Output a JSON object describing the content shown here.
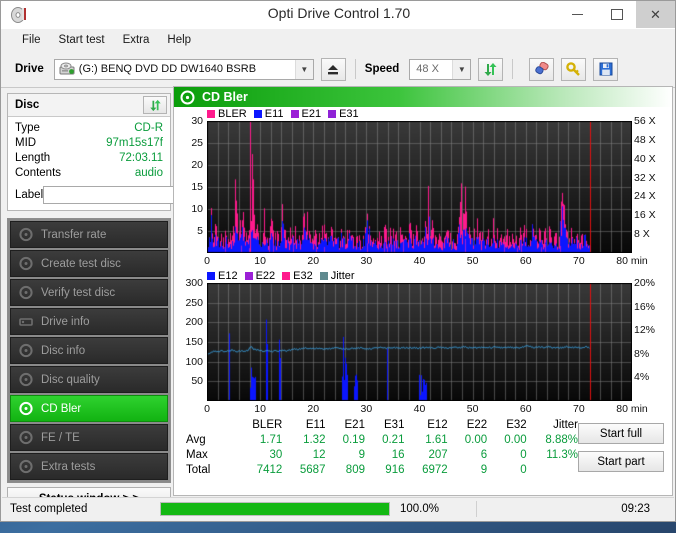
{
  "window": {
    "title": "Opti Drive Control 1.70",
    "icon": "disc-icon",
    "buttons": {
      "minimize": "minimize",
      "maximize": "maximize",
      "close": "close"
    }
  },
  "menu": {
    "items": [
      "File",
      "Start test",
      "Extra",
      "Help"
    ]
  },
  "toolbar": {
    "drive_label": "Drive",
    "drive_value": "(G:)   BENQ DVD DD DW1640 BSRB",
    "eject_icon": "eject-icon",
    "speed_label": "Speed",
    "speed_value": "48 X",
    "refresh_icon": "refresh-icon",
    "eraser_icon": "eraser-icon",
    "key_icon": "key-icon",
    "save_icon": "save-icon"
  },
  "disc": {
    "header": "Disc",
    "refresh_icon": "refresh-icon",
    "rows": [
      {
        "key": "Type",
        "value": "CD-R"
      },
      {
        "key": "MID",
        "value": "97m15s17f"
      },
      {
        "key": "Length",
        "value": "72:03.11"
      },
      {
        "key": "Contents",
        "value": "audio"
      }
    ],
    "label_key": "Label",
    "label_value": "",
    "label_placeholder": "",
    "cd_button_icon": "cd-icon"
  },
  "nav": {
    "items": [
      {
        "label": "Transfer rate",
        "icon": "disc-icon",
        "selected": false
      },
      {
        "label": "Create test disc",
        "icon": "disc-icon",
        "selected": false
      },
      {
        "label": "Verify test disc",
        "icon": "disc-icon",
        "selected": false
      },
      {
        "label": "Drive info",
        "icon": "drive-icon",
        "selected": false
      },
      {
        "label": "Disc info",
        "icon": "disc-icon",
        "selected": false
      },
      {
        "label": "Disc quality",
        "icon": "disc-icon",
        "selected": false
      },
      {
        "label": "CD Bler",
        "icon": "disc-icon",
        "selected": true
      },
      {
        "label": "FE / TE",
        "icon": "disc-icon",
        "selected": false
      },
      {
        "label": "Extra tests",
        "icon": "disc-icon",
        "selected": false
      }
    ],
    "status_window": "Status window > >"
  },
  "section": {
    "title": "CD Bler",
    "icon": "disc-icon"
  },
  "colors": {
    "bler": "#ff1a8c",
    "e11": "#0b16ff",
    "e21": "#9b1fd6",
    "e31": "#8f23d6",
    "e12": "#0b16ff",
    "e22": "#9b1fd6",
    "e32": "#ff1a8c",
    "jitter": "#5f8a8f",
    "jitter_line": "#3aa5e8",
    "accent_green": "#0a9c3c",
    "selected_nav": "#1fbf1f",
    "end_marker": "#e01010"
  },
  "chart_data": [
    {
      "type": "line",
      "id": "cd-bler-chart",
      "title": "CD Bler",
      "xlabel": "min",
      "ylabel": "",
      "xlim": [
        0,
        80
      ],
      "ylim": [
        0,
        30
      ],
      "xticks": [
        0,
        10,
        20,
        30,
        40,
        50,
        60,
        70,
        80
      ],
      "xtick_labels": [
        "0",
        "10",
        "20",
        "30",
        "40",
        "50",
        "60",
        "70",
        "80 min"
      ],
      "yticks": [
        5,
        10,
        15,
        20,
        25,
        30
      ],
      "ytick_labels": [
        "5",
        "10",
        "15",
        "20",
        "25",
        "30"
      ],
      "y2lim": [
        0,
        56
      ],
      "y2ticks": [
        8,
        16,
        24,
        32,
        40,
        48,
        56
      ],
      "y2tick_labels": [
        "8 X",
        "16 X",
        "24 X",
        "32 X",
        "40 X",
        "48 X",
        "56 X"
      ],
      "grid": true,
      "legend": [
        {
          "name": "BLER",
          "color": "#ff1a8c"
        },
        {
          "name": "E11",
          "color": "#0b16ff"
        },
        {
          "name": "E21",
          "color": "#9b1fd6"
        },
        {
          "name": "E31",
          "color": "#8f23d6"
        }
      ],
      "legend_position": "top-left",
      "data_end_min": 72.05,
      "end_marker_min": 72.05,
      "series": [
        {
          "name": "BLER",
          "color": "#ff1a8c",
          "values": [
            2,
            5,
            14,
            4,
            3,
            6,
            5,
            3,
            4,
            2,
            3,
            5,
            4,
            3,
            2,
            4,
            6,
            30,
            12,
            8,
            11,
            10,
            9,
            6,
            5,
            4,
            8,
            7,
            20,
            10,
            5,
            6,
            4,
            3,
            5,
            7,
            6,
            4,
            3,
            5,
            8,
            6,
            4,
            3,
            5,
            4,
            6,
            12,
            8,
            5,
            4,
            3,
            5,
            4,
            3,
            6,
            5,
            4,
            3,
            5,
            16,
            14,
            8,
            6,
            5,
            4,
            3,
            5,
            4,
            3,
            5,
            4,
            6,
            5,
            4,
            3,
            5,
            8,
            6,
            4,
            3,
            5,
            4,
            3,
            6,
            5,
            4,
            3,
            5,
            9,
            7,
            5,
            4,
            3,
            5,
            4,
            3,
            5,
            4,
            6,
            10,
            7,
            5,
            4,
            3,
            5,
            4,
            3,
            5,
            4,
            3,
            6,
            5,
            4,
            3,
            5,
            4,
            6,
            5,
            4,
            3,
            5,
            4,
            3,
            5,
            4,
            3,
            6,
            5,
            4,
            9,
            7,
            5,
            4,
            3,
            5,
            4,
            8,
            6,
            13,
            9,
            7,
            5,
            4,
            3,
            5,
            4,
            3,
            5,
            4,
            6,
            5,
            4,
            3,
            5,
            4,
            3,
            5,
            16,
            13,
            10,
            8,
            11,
            9,
            7,
            5,
            4,
            3,
            5,
            7,
            6,
            4,
            3,
            5,
            4,
            3,
            5,
            4,
            3,
            5,
            4,
            3,
            5,
            4,
            6,
            5,
            4,
            3,
            5,
            4,
            3,
            5,
            4,
            3,
            5,
            4,
            3,
            5,
            4,
            6,
            5,
            4,
            3,
            5,
            9,
            7,
            5,
            4,
            3,
            5,
            4,
            3,
            5,
            4,
            3,
            5,
            4,
            3,
            5,
            4,
            3,
            5,
            12,
            14,
            10,
            8,
            6,
            4,
            3,
            5,
            4,
            3,
            5,
            4,
            3,
            5,
            4,
            6,
            5,
            4,
            3
          ]
        },
        {
          "name": "E11",
          "color": "#0b16ff",
          "values": [
            2,
            4,
            9,
            3,
            2,
            4,
            3,
            2,
            3,
            2,
            2,
            4,
            3,
            2,
            2,
            3,
            4,
            10,
            6,
            5,
            7,
            6,
            5,
            4,
            3,
            3,
            5,
            4,
            9,
            6,
            3,
            4,
            3,
            2,
            3,
            5,
            4,
            3,
            2,
            3,
            5,
            4,
            3,
            2,
            3,
            3,
            4,
            7,
            5,
            3,
            3,
            2,
            3,
            3,
            2,
            4,
            3,
            3,
            2,
            3,
            10,
            8,
            5,
            4,
            3,
            3,
            2,
            3,
            3,
            2,
            3,
            3,
            4,
            3,
            3,
            2,
            3,
            5,
            4,
            3,
            2,
            3,
            3,
            2,
            4,
            3,
            3,
            2,
            3,
            6,
            5,
            3,
            3,
            2,
            3,
            3,
            2,
            3,
            3,
            4,
            7,
            5,
            3,
            3,
            2,
            3,
            3,
            2,
            3,
            3,
            2,
            4,
            3,
            3,
            2,
            3,
            3,
            4,
            3,
            3,
            2,
            3,
            3,
            2,
            3,
            3,
            2,
            4,
            3,
            3,
            6,
            5,
            3,
            3,
            2,
            3,
            3,
            5,
            4,
            8,
            6,
            5,
            3,
            3,
            2,
            3,
            3,
            2,
            3,
            3,
            4,
            3,
            3,
            2,
            3,
            3,
            2,
            3,
            10,
            8,
            6,
            5,
            7,
            6,
            5,
            3,
            3,
            2,
            3,
            5,
            4,
            3,
            2,
            3,
            3,
            2,
            3,
            3,
            2,
            3,
            3,
            2,
            3,
            3,
            4,
            3,
            3,
            2,
            3,
            3,
            2,
            3,
            3,
            2,
            3,
            3,
            2,
            3,
            3,
            4,
            3,
            3,
            2,
            3,
            6,
            5,
            3,
            3,
            2,
            3,
            3,
            2,
            3,
            3,
            2,
            3,
            3,
            2,
            3,
            3,
            2,
            3,
            8,
            9,
            7,
            5,
            4,
            3,
            2,
            3,
            3,
            2,
            3,
            3,
            2,
            3,
            3,
            4,
            3,
            3,
            2
          ]
        }
      ],
      "write_speed_profile": {
        "start_x": 8,
        "end_x": 40,
        "note": "no speed curve drawn"
      }
    },
    {
      "type": "line",
      "id": "cd-bler-jitter-chart",
      "title": "",
      "xlabel": "min",
      "xlim": [
        0,
        80
      ],
      "ylim": [
        0,
        300
      ],
      "xticks": [
        0,
        10,
        20,
        30,
        40,
        50,
        60,
        70,
        80
      ],
      "xtick_labels": [
        "0",
        "10",
        "20",
        "30",
        "40",
        "50",
        "60",
        "70",
        "80 min"
      ],
      "yticks": [
        50,
        100,
        150,
        200,
        250,
        300
      ],
      "ytick_labels": [
        "50",
        "100",
        "150",
        "200",
        "250",
        "300"
      ],
      "y2lim": [
        0,
        20
      ],
      "y2ticks": [
        4,
        8,
        12,
        16,
        20
      ],
      "y2tick_labels": [
        "4%",
        "8%",
        "12%",
        "16%",
        "20%"
      ],
      "grid": true,
      "legend": [
        {
          "name": "E12",
          "color": "#0b16ff"
        },
        {
          "name": "E22",
          "color": "#9b1fd6"
        },
        {
          "name": "E32",
          "color": "#ff1a8c"
        },
        {
          "name": "Jitter",
          "color": "#5f8a8f"
        }
      ],
      "legend_position": "top-left",
      "data_end_min": 72.05,
      "end_marker_min": 72.05,
      "series": [
        {
          "name": "Jitter",
          "color": "#3aa5e8",
          "axis": "right",
          "values": [
            8.0,
            8.2,
            8.3,
            8.4,
            8.45,
            8.4,
            8.5,
            8.45,
            8.4,
            8.5,
            8.6,
            8.5,
            8.45,
            8.4,
            8.5,
            8.45,
            8.5,
            8.6,
            9.4,
            8.8,
            8.7,
            8.6,
            8.5,
            8.45,
            8.4,
            8.5,
            8.45,
            8.4,
            8.5,
            8.45,
            8.5,
            8.6,
            8.55,
            8.5,
            8.6,
            8.7,
            8.8,
            8.7,
            8.8,
            8.9,
            9.0,
            8.9,
            8.85,
            8.9,
            8.85,
            8.9,
            8.95,
            8.9,
            8.85,
            8.9,
            8.85,
            8.9,
            8.95,
            9.0,
            8.95,
            8.9,
            8.85,
            8.9,
            8.85,
            8.9,
            8.95,
            8.9,
            8.95,
            9.0,
            8.9,
            8.85,
            8.9,
            8.85,
            8.9,
            8.95,
            9.0,
            9.1,
            9.0,
            8.95,
            8.9,
            8.95,
            9.0,
            9.1,
            9.0,
            8.95,
            9.0,
            9.05,
            9.0,
            8.95,
            9.0,
            9.05,
            9.0,
            8.95,
            9.0,
            9.05,
            9.0,
            9.1,
            9.0,
            8.95,
            9.0,
            9.05,
            9.1,
            9.0,
            8.95,
            9.0,
            9.05,
            9.0,
            9.1,
            9.05,
            9.0,
            9.1,
            9.2,
            9.1,
            9.0,
            9.05,
            9.1,
            9.0,
            9.05,
            9.1,
            9.0,
            9.05,
            9.1,
            9.0,
            9.1,
            9.2,
            9.1,
            9.0,
            9.1,
            9.05,
            9.0,
            9.1,
            9.0,
            9.05,
            9.1,
            9.0,
            9.1,
            9.2,
            9.3,
            9.2,
            9.1,
            9.0,
            9.1,
            9.2,
            9.1,
            9.0,
            9.1,
            9.2,
            9.1,
            9.0,
            9.1,
            9.05,
            9.0,
            9.1,
            9.2,
            9.1,
            9.0,
            9.1,
            9.2,
            9.1,
            9.0,
            9.1,
            9.2,
            9.1,
            9.0
          ]
        },
        {
          "name": "E12",
          "color": "#0b16ff",
          "spikes": [
            {
              "x": 4.1,
              "y": 172
            },
            {
              "x": 8.3,
              "y": 85
            },
            {
              "x": 8.6,
              "y": 60
            },
            {
              "x": 11.2,
              "y": 207
            },
            {
              "x": 13.6,
              "y": 156
            },
            {
              "x": 25.6,
              "y": 163
            },
            {
              "x": 25.9,
              "y": 110
            },
            {
              "x": 26.2,
              "y": 95
            },
            {
              "x": 33.8,
              "y": 133
            },
            {
              "x": 40.2,
              "y": 57
            },
            {
              "x": 40.9,
              "y": 50
            }
          ]
        }
      ]
    }
  ],
  "stats": {
    "columns": [
      "BLER",
      "E11",
      "E21",
      "E31",
      "E12",
      "E22",
      "E32",
      "Jitter"
    ],
    "rows": [
      {
        "label": "Avg",
        "values": [
          "1.71",
          "1.32",
          "0.19",
          "0.21",
          "1.61",
          "0.00",
          "0.00",
          "8.88%"
        ]
      },
      {
        "label": "Max",
        "values": [
          "30",
          "12",
          "9",
          "16",
          "207",
          "6",
          "0",
          "11.3%"
        ]
      },
      {
        "label": "Total",
        "values": [
          "7412",
          "5687",
          "809",
          "916",
          "6972",
          "9",
          "0",
          ""
        ]
      }
    ]
  },
  "actions": {
    "start_full": "Start full",
    "start_part": "Start part"
  },
  "statusbar": {
    "message": "Test completed",
    "progress_percent": 100,
    "progress_label": "100.0%",
    "time": "09:23"
  }
}
